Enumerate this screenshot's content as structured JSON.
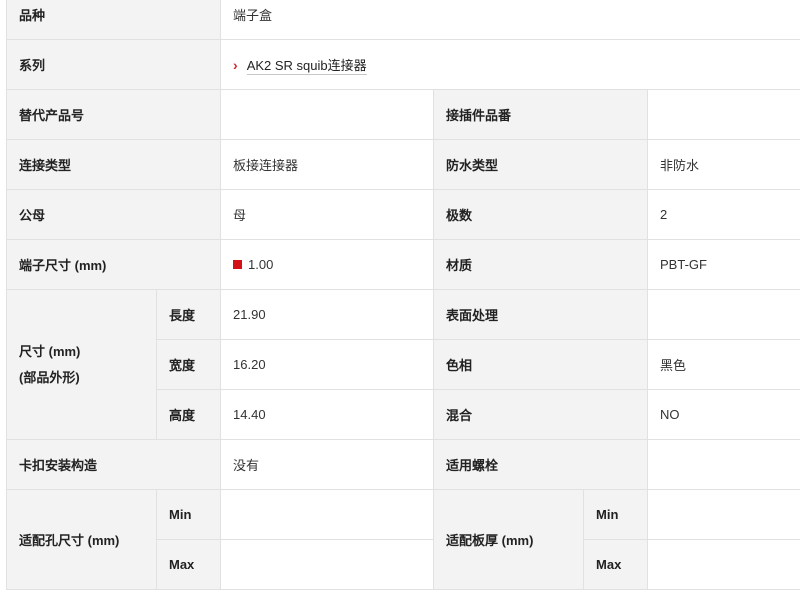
{
  "rows": {
    "hinshu": {
      "label": "品种",
      "value": "端子盒"
    },
    "series": {
      "label": "系列",
      "value": "AK2 SR squib连接器"
    },
    "alt_part": {
      "label": "替代产品号",
      "value": "",
      "label2": "接插件品番",
      "value2": ""
    },
    "conn_type": {
      "label": "连接类型",
      "value": "板接连接器",
      "label2": "防水类型",
      "value2": "非防水"
    },
    "gender": {
      "label": "公母",
      "value": "母",
      "label2": "极数",
      "value2": "2"
    },
    "terminal": {
      "label": "端子尺寸 (mm)",
      "value": "1.00",
      "marker_color": "#d2111b",
      "label2": "材质",
      "value2": "PBT-GF"
    },
    "dimension": {
      "label_line1": "尺寸 (mm)",
      "label_line2": "(部品外形)",
      "length": {
        "label": "長度",
        "value": "21.90"
      },
      "width": {
        "label": "宽度",
        "value": "16.20"
      },
      "height": {
        "label": "高度",
        "value": "14.40"
      }
    },
    "surface": {
      "label": "表面处理",
      "value": ""
    },
    "color": {
      "label": "色相",
      "value": "黑色"
    },
    "mixed": {
      "label": "混合",
      "value": "NO"
    },
    "clip": {
      "label": "卡扣安装构造",
      "value": "没有",
      "label2": "适用螺栓",
      "value2": ""
    },
    "hole": {
      "label": "适配孔尺寸 (mm)",
      "min_label": "Min",
      "max_label": "Max",
      "min_value": "",
      "max_value": ""
    },
    "board": {
      "label": "适配板厚 (mm)",
      "min_label": "Min",
      "max_label": "Max",
      "min_value": "",
      "max_value": ""
    }
  },
  "colors": {
    "label_bg": "#f3f3f3",
    "border": "#e1e1e1",
    "accent": "#d2242b"
  },
  "icons": {
    "series_link": "chevron-right-icon",
    "terminal_marker": "red-square-icon"
  }
}
